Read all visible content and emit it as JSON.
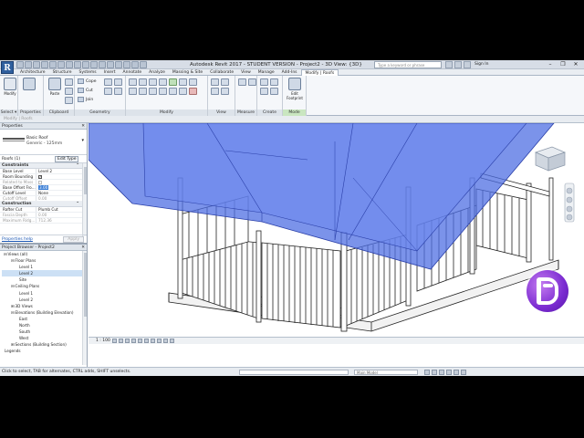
{
  "app": {
    "logo_letter": "R",
    "title": "Autodesk Revit 2017 - STUDENT VERSION -   Project2 - 3D View: {3D}",
    "search_placeholder": "Type a keyword or phrase",
    "sign_in": "Sign In",
    "window_controls": [
      "–",
      "❐",
      "✕"
    ]
  },
  "tabs": [
    {
      "label": "Architecture",
      "context": false
    },
    {
      "label": "Structure",
      "context": false
    },
    {
      "label": "Systems",
      "context": false
    },
    {
      "label": "Insert",
      "context": false
    },
    {
      "label": "Annotate",
      "context": false
    },
    {
      "label": "Analyze",
      "context": false
    },
    {
      "label": "Massing & Site",
      "context": false
    },
    {
      "label": "Collaborate",
      "context": false
    },
    {
      "label": "View",
      "context": false
    },
    {
      "label": "Manage",
      "context": false
    },
    {
      "label": "Add-Ins",
      "context": false
    },
    {
      "label": "Modify | Roofs",
      "context": true
    }
  ],
  "ribbon": {
    "modify_label": "Modify",
    "panels": {
      "select": "Select ▾",
      "properties": "Properties",
      "clipboard": "Clipboard",
      "geometry": "Geometry",
      "modify": "Modify",
      "view": "View",
      "measure": "Measure",
      "create": "Create",
      "mode": "Mode"
    },
    "paste_label": "Paste",
    "geometry_items": [
      "Cope",
      "Cut",
      "Join"
    ],
    "edit_footprint": "Edit Footprint"
  },
  "options_bar": "Modify | Roofs",
  "properties": {
    "header": "Properties",
    "close": "✕",
    "type_name": "Basic Roof",
    "type_sub": "Generic - 125mm",
    "instance_selector": "Roofs (1)",
    "edit_type": "Edit Type",
    "sections": [
      {
        "title": "Constraints",
        "rows": [
          {
            "k": "Base Level",
            "v": "Level 2",
            "dim": false
          },
          {
            "k": "Room Bounding",
            "v": "✓",
            "dim": false,
            "check": true
          },
          {
            "k": "Related to Mass",
            "v": "",
            "dim": true,
            "check": true
          },
          {
            "k": "Base Offset Fro...",
            "v": "3.00",
            "dim": false,
            "highlight": true
          },
          {
            "k": "Cutoff Level",
            "v": "None",
            "dim": false
          },
          {
            "k": "Cutoff Offset",
            "v": "0.00",
            "dim": true
          }
        ]
      },
      {
        "title": "Construction",
        "rows": [
          {
            "k": "Rafter Cut",
            "v": "Plumb Cut",
            "dim": false
          },
          {
            "k": "Fascia Depth",
            "v": "0.00",
            "dim": true
          },
          {
            "k": "Maximum Ridg...",
            "v": "712.36",
            "dim": true
          }
        ]
      }
    ],
    "help": "Properties help",
    "apply": "Apply"
  },
  "project_browser": {
    "header": "Project Browser - Project2",
    "close": "✕",
    "nodes": [
      {
        "label": "Views (all)",
        "depth": 0,
        "toggle": "⊟"
      },
      {
        "label": "Floor Plans",
        "depth": 1,
        "toggle": "⊟"
      },
      {
        "label": "Level 1",
        "depth": 2,
        "toggle": ""
      },
      {
        "label": "Level 2",
        "depth": 2,
        "toggle": "",
        "selected": true
      },
      {
        "label": "Site",
        "depth": 2,
        "toggle": ""
      },
      {
        "label": "Ceiling Plans",
        "depth": 1,
        "toggle": "⊟"
      },
      {
        "label": "Level 1",
        "depth": 2,
        "toggle": ""
      },
      {
        "label": "Level 2",
        "depth": 2,
        "toggle": ""
      },
      {
        "label": "3D Views",
        "depth": 1,
        "toggle": "⊞"
      },
      {
        "label": "Elevations (Building Elevation)",
        "depth": 1,
        "toggle": "⊟"
      },
      {
        "label": "East",
        "depth": 2,
        "toggle": ""
      },
      {
        "label": "North",
        "depth": 2,
        "toggle": ""
      },
      {
        "label": "South",
        "depth": 2,
        "toggle": ""
      },
      {
        "label": "West",
        "depth": 2,
        "toggle": ""
      },
      {
        "label": "Sections (Building Section)",
        "depth": 1,
        "toggle": "⊞"
      },
      {
        "label": "Legends",
        "depth": 0,
        "toggle": ""
      }
    ]
  },
  "view_bar": {
    "scale": "1 : 100"
  },
  "status": {
    "message": "Click to select, TAB for alternates, CTRL adds, SHIFT unselects.",
    "model": "Main Model"
  },
  "colors": {
    "roof_selection": "#4f6fe3",
    "context_tab": "#c9e6c0",
    "logo": "#7b2bd1"
  }
}
